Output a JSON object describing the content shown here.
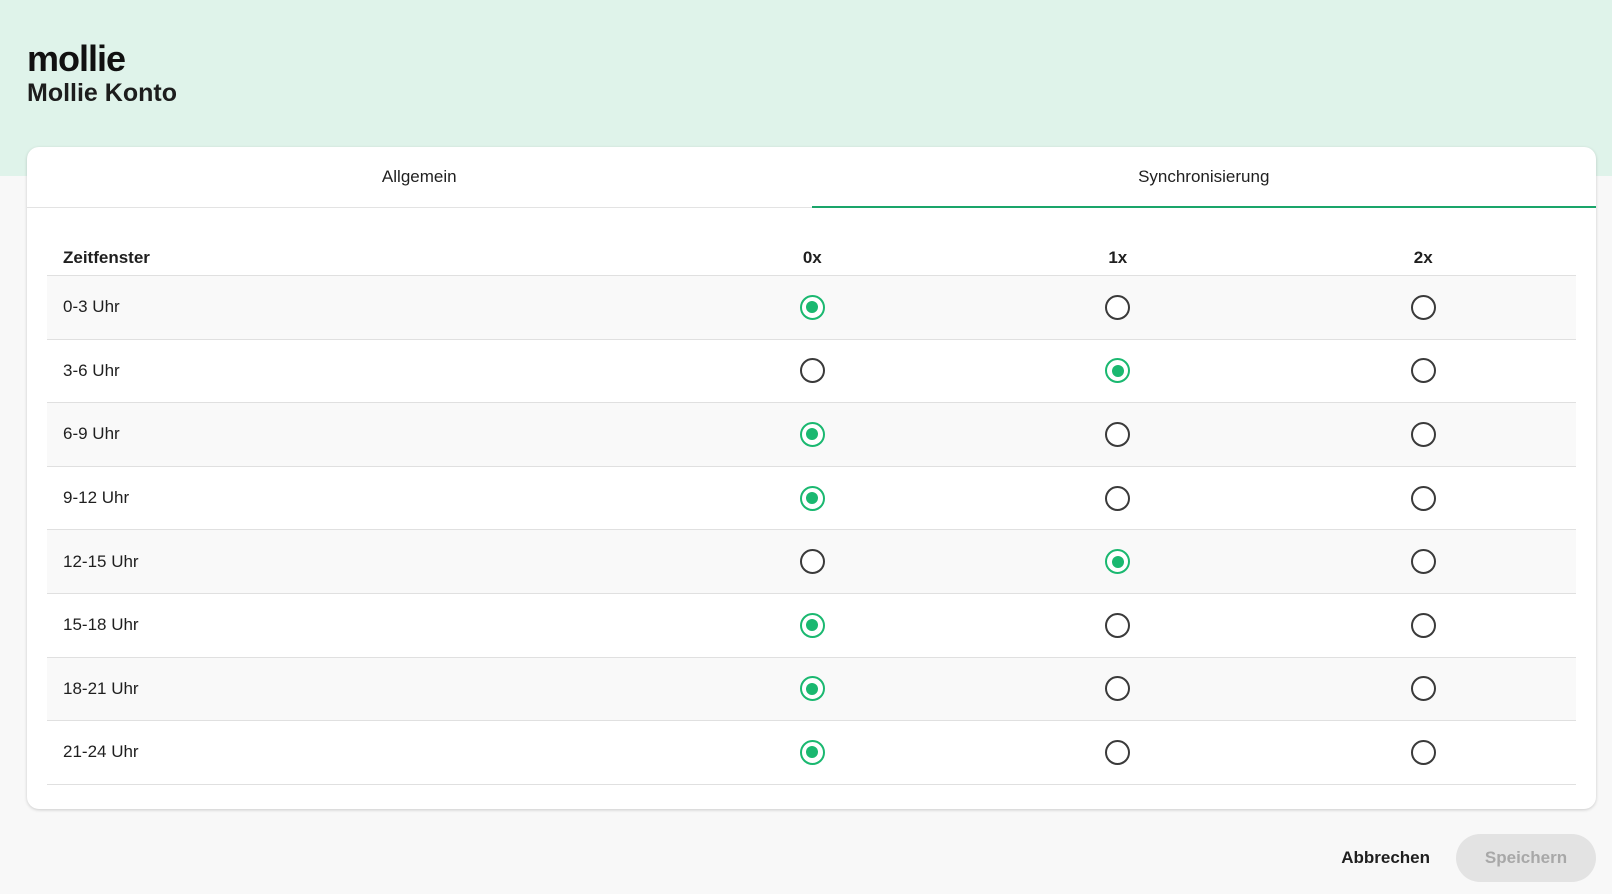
{
  "header": {
    "logo": "mollie",
    "title": "Mollie Konto"
  },
  "tabs": [
    {
      "label": "Allgemein",
      "active": false
    },
    {
      "label": "Synchronisierung",
      "active": true
    }
  ],
  "table": {
    "columns": [
      "Zeitfenster",
      "0x",
      "1x",
      "2x"
    ],
    "rows": [
      {
        "label": "0-3 Uhr",
        "selected": 0
      },
      {
        "label": "3-6 Uhr",
        "selected": 1
      },
      {
        "label": "6-9 Uhr",
        "selected": 0
      },
      {
        "label": "9-12 Uhr",
        "selected": 0
      },
      {
        "label": "12-15 Uhr",
        "selected": 1
      },
      {
        "label": "15-18 Uhr",
        "selected": 0
      },
      {
        "label": "18-21 Uhr",
        "selected": 0
      },
      {
        "label": "21-24 Uhr",
        "selected": 0
      }
    ]
  },
  "footer": {
    "cancel_label": "Abbrechen",
    "save_label": "Speichern"
  },
  "colors": {
    "accent": "#1ab870",
    "top_band": "#dff3ea"
  }
}
